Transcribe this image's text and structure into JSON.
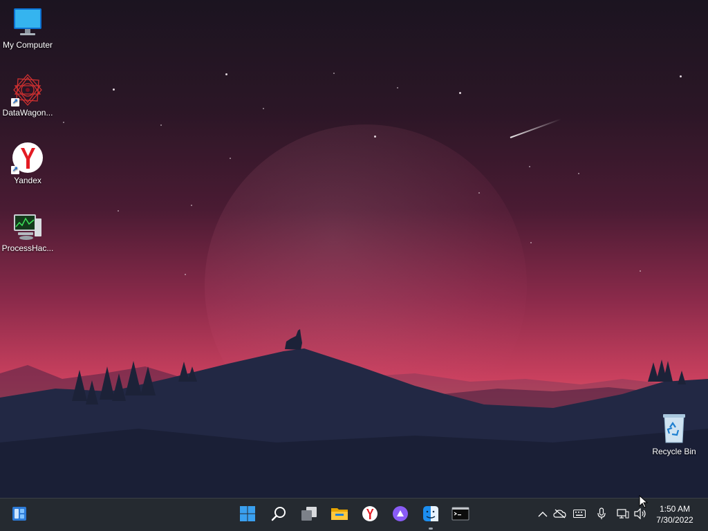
{
  "desktop": {
    "icons": [
      {
        "label": "My Computer",
        "icon": "monitor-icon",
        "shortcut": false
      },
      {
        "label": "DataWagon...",
        "icon": "datawagon-icon",
        "shortcut": true
      },
      {
        "label": "Yandex",
        "icon": "yandex-browser-icon",
        "shortcut": true
      },
      {
        "label": "ProcessHac...",
        "icon": "process-hacker-icon",
        "shortcut": false
      }
    ],
    "recycle_bin": {
      "label": "Recycle Bin",
      "icon": "recycle-bin-icon"
    },
    "wallpaper": {
      "theme": "wolf howling at moon over mountains",
      "colors": [
        "#1b1420",
        "#8a2a4a",
        "#e57a6a",
        "#1d2338"
      ]
    }
  },
  "taskbar": {
    "widgets": {
      "icon": "widgets-icon"
    },
    "pinned": [
      {
        "icon": "start-windows-icon",
        "active": false
      },
      {
        "icon": "search-icon",
        "active": false
      },
      {
        "icon": "task-view-icon",
        "active": false
      },
      {
        "icon": "file-explorer-icon",
        "active": false
      },
      {
        "icon": "yandex-browser-icon",
        "active": false
      },
      {
        "icon": "alice-assistant-icon",
        "active": false
      },
      {
        "icon": "finder-icon",
        "active": true
      },
      {
        "icon": "terminal-icon",
        "active": false
      }
    ],
    "tray": [
      {
        "icon": "chevron-up-icon"
      },
      {
        "icon": "cloud-offline-icon"
      },
      {
        "icon": "keyboard-icon"
      },
      {
        "icon": "microphone-icon"
      },
      {
        "icon": "network-icon"
      },
      {
        "icon": "volume-icon"
      }
    ],
    "clock": {
      "time": "1:50 AM",
      "date": "7/30/2022"
    }
  }
}
